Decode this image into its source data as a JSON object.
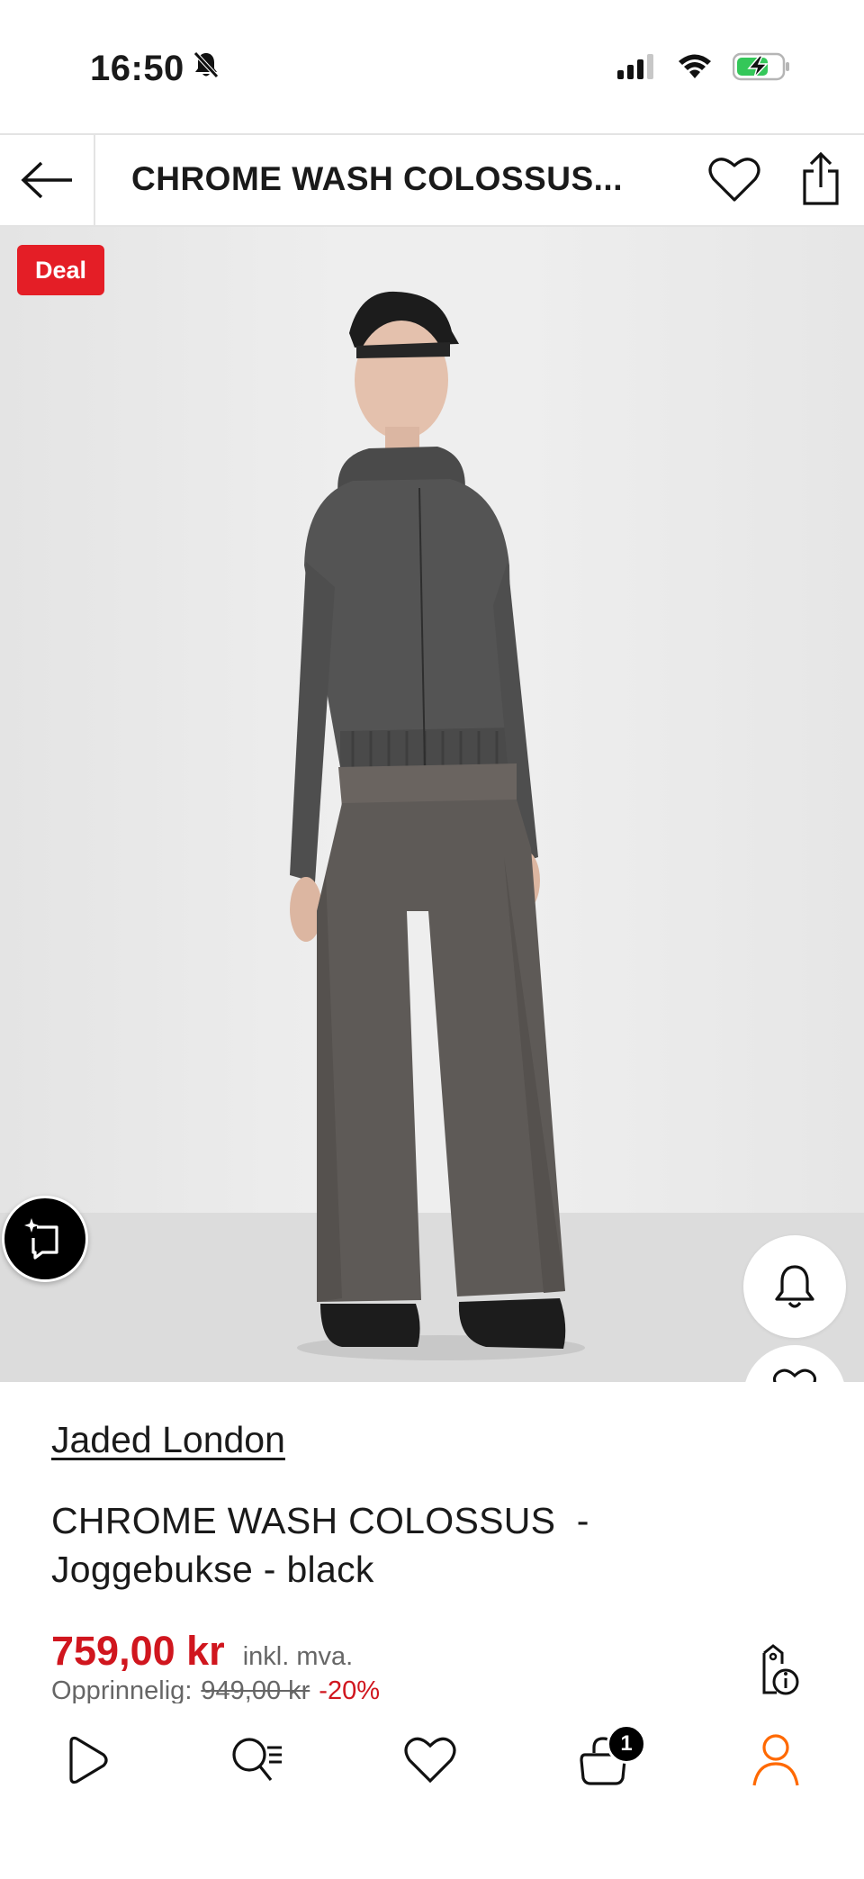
{
  "status_bar": {
    "time": "16:50"
  },
  "header": {
    "title": "CHROME WASH COLOSSUS..."
  },
  "product": {
    "badge": "Deal",
    "brand": "Jaded London",
    "name_line1": "CHROME WASH COLOSSUS  -",
    "name_line2": "Joggebukse - black",
    "price": "759,00 kr",
    "vat_note": "inkl. mva.",
    "original_label": "Opprinnelig:",
    "original_price": "949,00 kr",
    "discount": "-20%"
  },
  "nav": {
    "cart_count": "1"
  },
  "colors": {
    "accent_red": "#e41e26",
    "price_red": "#d0161e",
    "profile_orange": "#ff6900"
  },
  "icons": [
    "bell-slash-icon",
    "signal-icon",
    "wifi-icon",
    "battery-charging-icon",
    "back-arrow-icon",
    "heart-icon",
    "share-icon",
    "ai-sparkle-icon",
    "bell-icon",
    "price-tag-info-icon",
    "play-icon",
    "search-list-icon",
    "cart-icon",
    "profile-icon"
  ]
}
